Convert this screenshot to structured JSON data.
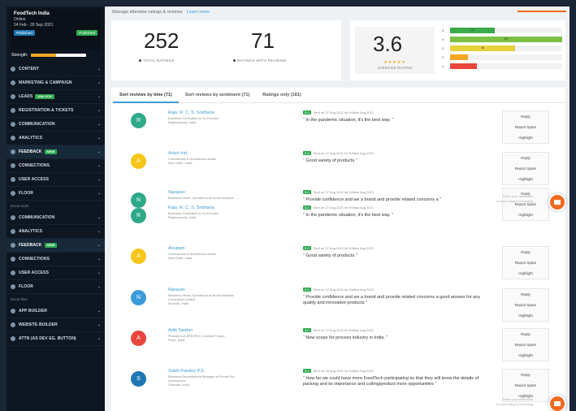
{
  "event": {
    "title": "FoodTech India",
    "line1": "Online",
    "line2": "24 Feb - 26 Sep 2021",
    "badge_left": "Published",
    "badge_right": "Published"
  },
  "strength": {
    "label": "Strength:",
    "fill_percent": 45
  },
  "sidebar": {
    "group1": [
      {
        "label": "CONTENT",
        "icon": "content-icon"
      },
      {
        "label": "MARKETING & CAMPAIGN",
        "icon": "megaphone-icon"
      },
      {
        "label": "LEADS",
        "icon": "leads-icon",
        "badge": "Unlock"
      },
      {
        "label": "REGISTRATION & TICKETS",
        "icon": "ticket-icon"
      },
      {
        "label": "COMMUNICATION",
        "icon": "chat-icon"
      },
      {
        "label": "ANALYTICS",
        "icon": "chart-icon"
      },
      {
        "label": "FEEDBACK",
        "icon": "feedback-icon",
        "badge": "New"
      },
      {
        "label": "CONNECTIONS",
        "icon": "connections-icon"
      },
      {
        "label": "USER ACCESS",
        "icon": "user-access-icon"
      },
      {
        "label": "FLOOR",
        "icon": "floor-icon"
      }
    ],
    "section2": "Event tools",
    "group2": [
      {
        "label": "COMMUNICATION",
        "icon": "chat-icon"
      },
      {
        "label": "ANALYTICS",
        "icon": "chart-icon"
      },
      {
        "label": "FEEDBACK",
        "icon": "feedback-icon",
        "badge": "New"
      },
      {
        "label": "CONNECTIONS",
        "icon": "connections-icon"
      },
      {
        "label": "USER ACCESS",
        "icon": "user-access-icon"
      },
      {
        "label": "FLOOR",
        "icon": "floor-icon"
      }
    ],
    "section3": "Event files",
    "group3": [
      {
        "label": "APP BUILDER",
        "icon": "app-builder-icon"
      },
      {
        "label": "WEBSITE BUILDER",
        "icon": "website-icon"
      },
      {
        "label": "ATTN (as dev eg. button)",
        "icon": "attn-icon"
      }
    ]
  },
  "header": {
    "subtitle": "Manage attendee ratings & reviews",
    "link": "Learn more"
  },
  "stats": {
    "total_ratings": "252",
    "total_ratings_label": "TOTAL RATINGS",
    "ratings_with_reviews": "71",
    "ratings_with_reviews_label": "RATINGS WITH REVIEWS",
    "average_rating": "3.6",
    "average_label": "AVERAGE RATING",
    "stars": "★★★★★"
  },
  "rating_bars": [
    {
      "label": "5",
      "percent": 40,
      "color": "#3aaa4a",
      "value": "75"
    },
    {
      "label": "4",
      "percent": 100,
      "color": "#7bc043",
      "value": "80"
    },
    {
      "label": "3",
      "percent": 58,
      "color": "#e6d23a",
      "value": "45"
    },
    {
      "label": "2",
      "percent": 16,
      "color": "#f5a623",
      "value": ""
    },
    {
      "label": "1",
      "percent": 24,
      "color": "#e8453c",
      "value": ""
    }
  ],
  "tabs": [
    {
      "label": "Sort reviews by time (71)"
    },
    {
      "label": "Sort reviews by sentiment (71)"
    },
    {
      "label": "Ratings only (181)"
    }
  ],
  "reviews": [
    {
      "initial": "R",
      "avatar_color": "#2eaa8a",
      "name": "Rajs. R. C. S. Sridhana",
      "sub1": "Business Consultant & Co-Founder",
      "sub2": "Rajahmundry, India",
      "meta": "Sent on 27 Aug 2021 for Edition Aug 2021",
      "text": "“ In the pandemic situation, it's the best way. ”"
    },
    {
      "initial": "A",
      "avatar_color": "#f5c518",
      "name": "Anish Ind.",
      "sub1": "Commercial & Operations Leader",
      "sub2": "New Delhi, India",
      "meta": "Sent on 27 Aug 2021 for Edition Aug 2021",
      "text": "“ Good variety of products ”"
    },
    {
      "initial": "N",
      "avatar_color": "#2eaa8a",
      "name": "Narayan",
      "sub1": "Business Head, Operations at Rudra Mumbai",
      "sub2": "",
      "meta": "Sent on 27 Aug 2021 for Edition Aug 2021",
      "text": "“ Provide confidence and we a brand and provide related concerns a ”"
    },
    {
      "initial": "R",
      "avatar_color": "#2eaa8a",
      "name": "Rajs. R. C. S. Sridhana",
      "sub1": "Business Consultant & Co-Founder",
      "sub2": "Rajahmundry, India",
      "meta": "Sent on 27 Aug 2021 for Edition Aug 2021",
      "text": "“ In the pandemic situation, it's the best way. ”"
    },
    {
      "initial": "A",
      "avatar_color": "#f5c518",
      "name": "Anupam",
      "sub1": "Commercial & Operations Leader",
      "sub2": "New Delhi, India",
      "meta": "Sent on 27 Aug 2021 for Edition Aug 2021",
      "text": "“ Good variety of products ”"
    },
    {
      "initial": "N",
      "avatar_color": "#3b9bd8",
      "name": "Narayan",
      "sub1": "Business Head, Operations at Rudra Mumbai",
      "sub2": "Consultant Limited",
      "sub3": "Mumbai, India",
      "meta": "Sent on 27 Aug 2021 for Edition Aug 2021",
      "text": "“ Provide confidence and we a brand and provide related concerns a good answer for any quality and innovative products ”"
    },
    {
      "initial": "A",
      "avatar_color": "#e8453c",
      "name": "Aditi Tandon",
      "sub1": "President at APEXFNC (Unified Foods)",
      "sub2": "Pune, India",
      "meta": "Sent on 27 Aug 2021 for Edition Aug 2021",
      "text": "“ New scope for process industry in India. ”"
    },
    {
      "initial": "S",
      "avatar_color": "#1f78b4",
      "name": "Sukhi Pandey P.S.",
      "sub1": "Business Development Manager at Rudra Pro",
      "sub2": "Accessories",
      "sub3": "Chennai, India",
      "meta": "Sent on 26 Aug 2021 for Edition Aug 2021",
      "text": "“ How far we could have more FoodTech participating so that they will know the details of packing and its importance and cutting/product more opportunities ”"
    }
  ],
  "actions": {
    "reply": "Reply",
    "report": "Report Spam",
    "highlight": "Highlight"
  },
  "chat": {
    "hint1": "Invite your attendees",
    "hint2": "to start rating & reviewing"
  }
}
